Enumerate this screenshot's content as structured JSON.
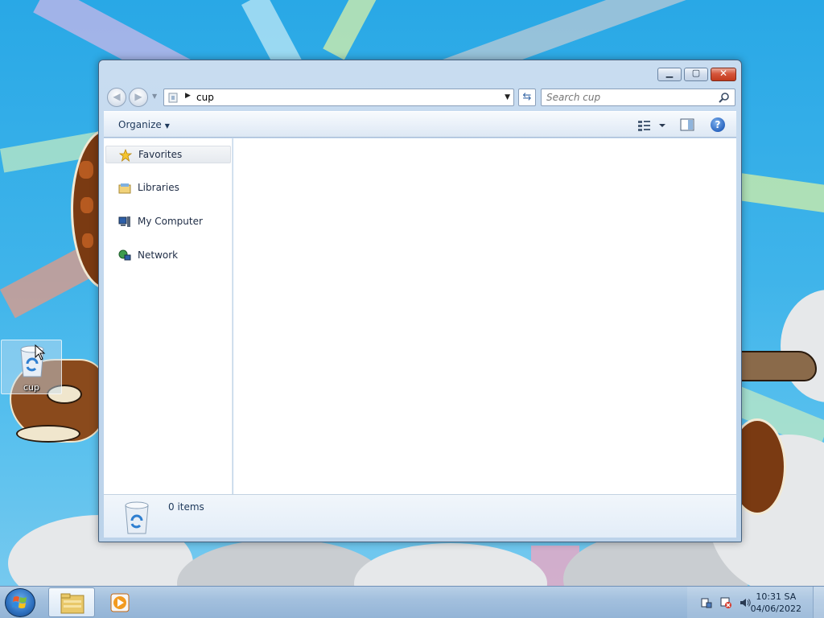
{
  "window": {
    "address_crumb": "cup",
    "search_placeholder": "Search cup",
    "organize_label": "Organize",
    "nav": [
      {
        "label": "Favorites",
        "icon": "star-icon"
      },
      {
        "label": "Libraries",
        "icon": "libraries-icon"
      },
      {
        "label": "My Computer",
        "icon": "computer-icon"
      },
      {
        "label": "Network",
        "icon": "network-icon"
      }
    ],
    "details": {
      "count": "0 items",
      "icon": "recycle-bin-icon"
    }
  },
  "desktop": {
    "icon_label": "cup",
    "icon": "recycle-bin-icon"
  },
  "taskbar": {
    "clock_time": "10:31 SA",
    "clock_date": "04/06/2022"
  },
  "colors": {
    "sky": "#29a8e6",
    "window_frame": "#bcd3ea",
    "close_button": "#c23a1d",
    "taskbar": "#a3c0de"
  }
}
